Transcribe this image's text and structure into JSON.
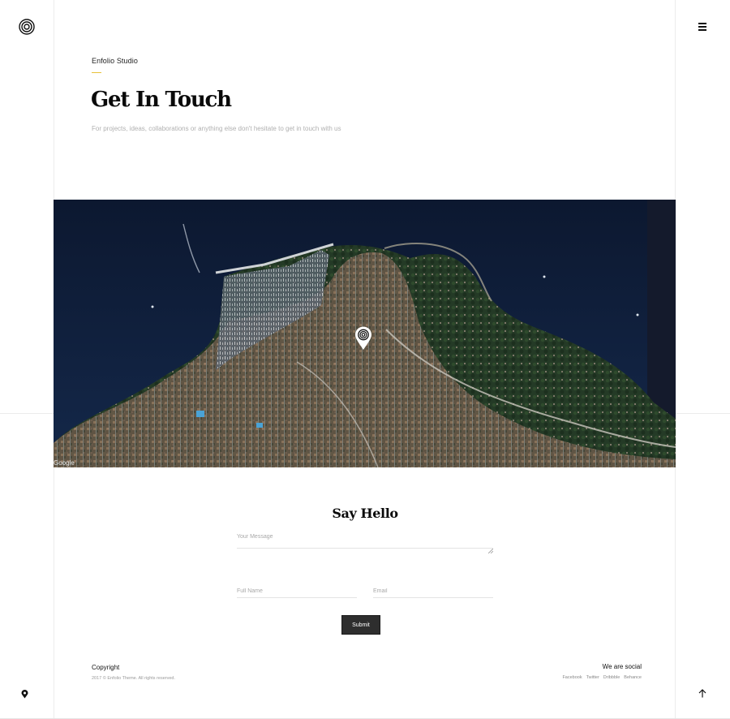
{
  "header": {
    "logo_icon": "concentric-circles-icon",
    "menu_icon": "hamburger-menu-icon"
  },
  "hero": {
    "eyebrow": "Enfolio Studio",
    "title": "Get In Touch",
    "subtitle": "For projects, ideas, collaborations or anything else don't hesitate to get in touch with us"
  },
  "map": {
    "attribution": "Google",
    "marker_icon": "map-marker-icon"
  },
  "form": {
    "title": "Say Hello",
    "message_placeholder": "Your Message",
    "name_placeholder": "Full Name",
    "email_placeholder": "Email",
    "submit_label": "Submit"
  },
  "footer": {
    "copyright_title": "Copyright",
    "copyright_text": "2017 © Enfolio Theme. All rights reserved.",
    "social_title": "We are social",
    "social_links": [
      "Facebook",
      "Twitter",
      "Dribbble",
      "Behance"
    ]
  },
  "side": {
    "location_icon": "location-pin-icon",
    "back_to_top_icon": "arrow-up-icon"
  },
  "colors": {
    "accent": "#e8c23a",
    "button": "#2e2e2e",
    "sea": "#0f1c33"
  }
}
